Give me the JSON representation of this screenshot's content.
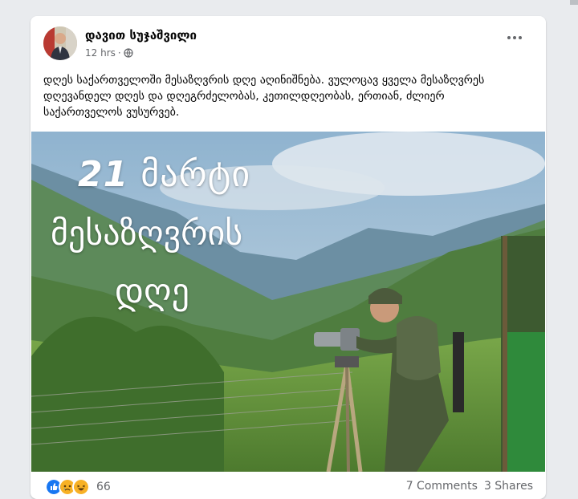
{
  "post": {
    "author": "დავით სუჯაშვილი",
    "time": "12 hrs",
    "separator": "·",
    "text": "დღეს საქართველოში მესაზღვრის დღე აღინიშნება. ვულოცავ ყველა მესაზღვრეს დღევანდელ დღეს და დღეგრძელობას, კეთილდღეობას, ერთიან, ძლიერ საქართველოს ვუსურვებ.",
    "image_text": {
      "day": "21",
      "month": "მარტი",
      "line2": "მესაზღვრის",
      "line3": "დღე"
    },
    "reactions": [
      "like",
      "sad",
      "haha"
    ],
    "reaction_count": "66",
    "comments": "7 Comments",
    "shares": "3 Shares"
  },
  "colors": {
    "like": "#1877f2",
    "sad": "#f7b125",
    "haha": "#f7b125",
    "text_secondary": "#65676b"
  }
}
